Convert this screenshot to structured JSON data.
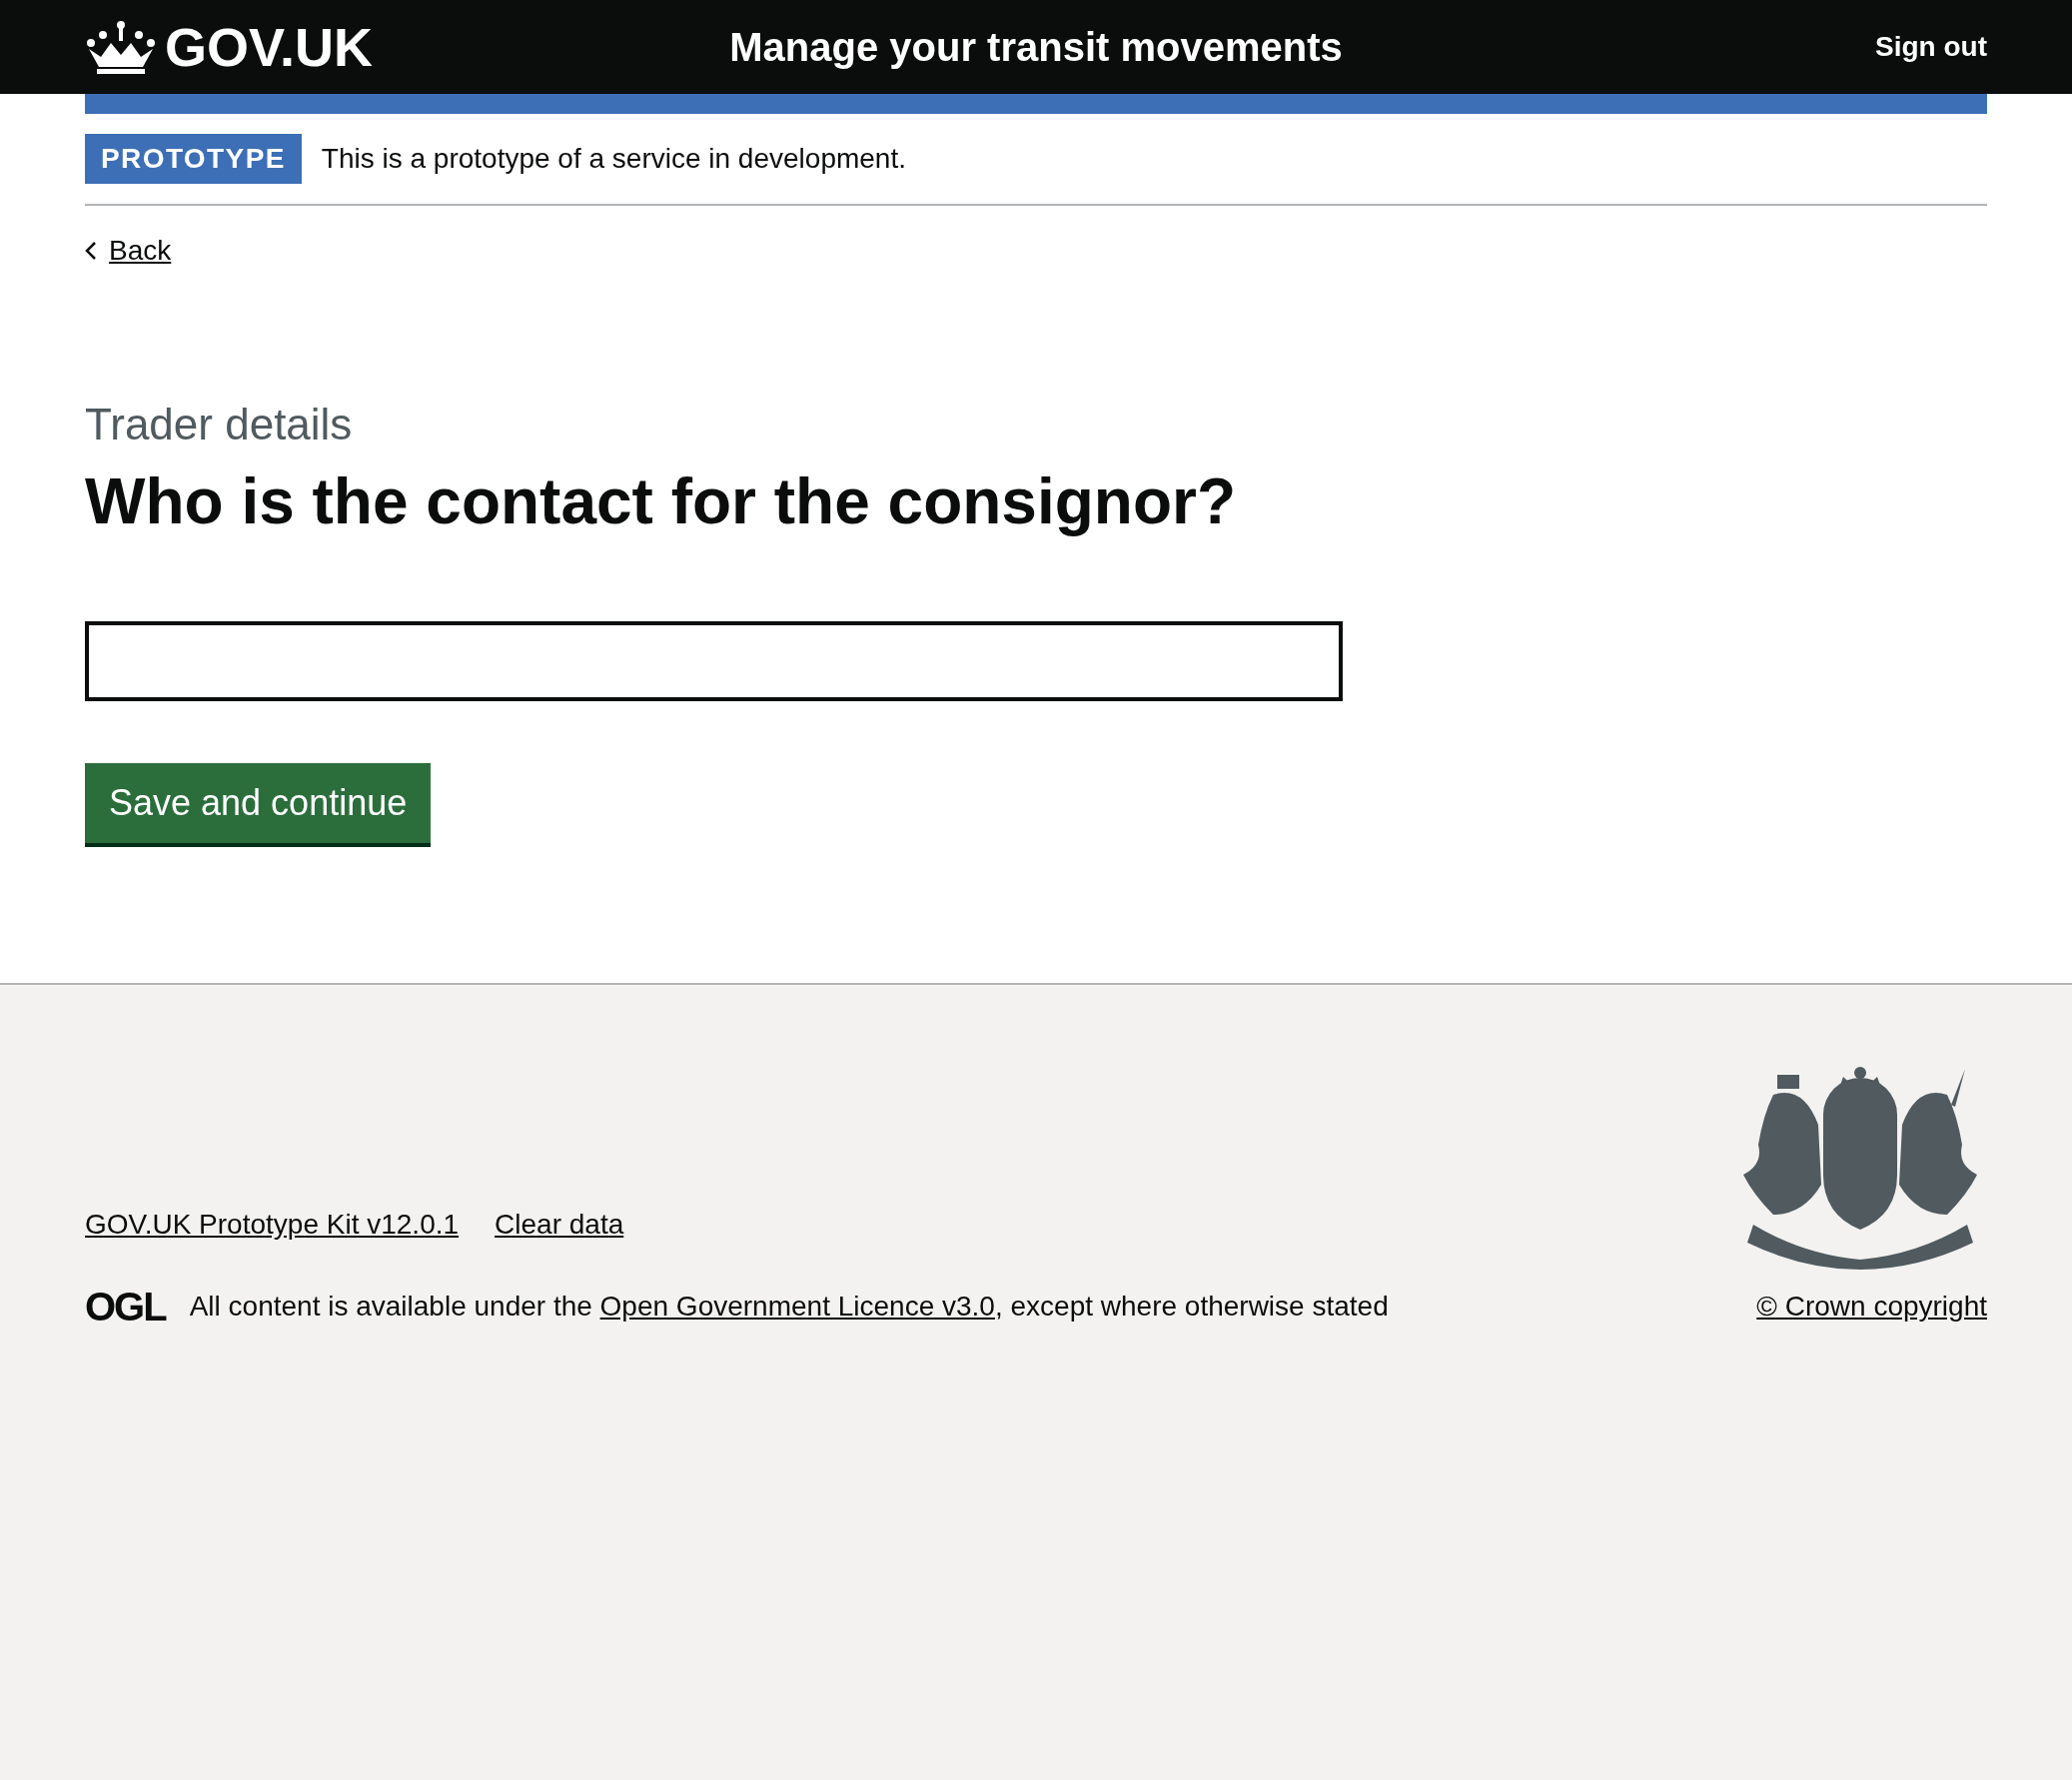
{
  "header": {
    "logo_text": "GOV.UK",
    "service_name": "Manage your transit movements",
    "sign_out": "Sign out"
  },
  "phase_banner": {
    "tag": "PROTOTYPE",
    "text": "This is a prototype of a service in development."
  },
  "back_link": "Back",
  "caption": "Trader details",
  "heading": "Who is the contact for the consignor?",
  "button": "Save and continue",
  "footer": {
    "links": [
      "GOV.UK Prototype Kit v12.0.1",
      "Clear data"
    ],
    "licence_logo": "OGL",
    "licence_before": "All content is available under the ",
    "licence_link": "Open Government Licence v3.0",
    "licence_after": ", except where otherwise stated",
    "copyright": "© Crown copyright"
  }
}
